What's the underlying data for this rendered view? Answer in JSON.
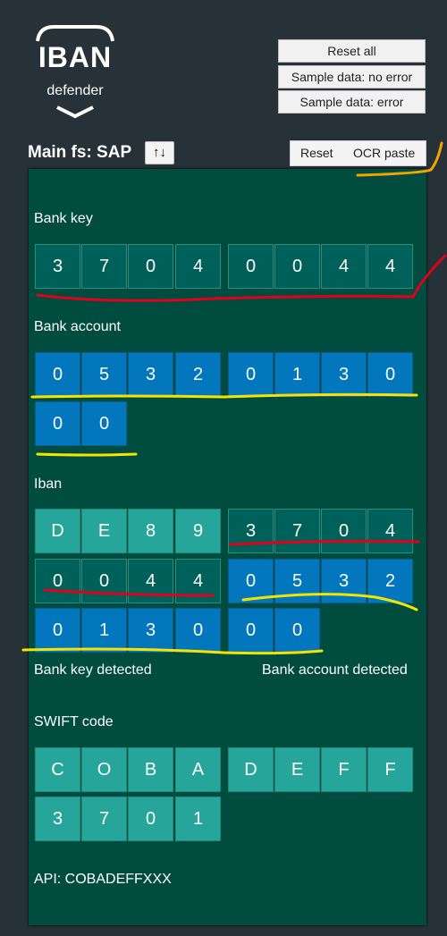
{
  "logo": {
    "title": "IBAN",
    "subtitle": "defender"
  },
  "buttons": {
    "reset_all": "Reset all",
    "sample_no_error": "Sample data: no error",
    "sample_error": "Sample data: error"
  },
  "main": {
    "label": "Main fs: SAP",
    "swap_icon": "↑↓"
  },
  "toolbar": {
    "reset": "Reset",
    "ocr_paste": "OCR paste"
  },
  "sections": {
    "bank_key": {
      "label": "Bank key",
      "digits": [
        "3",
        "7",
        "0",
        "4",
        "0",
        "0",
        "4",
        "4"
      ]
    },
    "bank_account": {
      "label": "Bank account",
      "digits": [
        "0",
        "5",
        "3",
        "2",
        "0",
        "1",
        "3",
        "0",
        "0",
        "0"
      ]
    },
    "iban": {
      "label": "Iban",
      "digits": [
        "D",
        "E",
        "8",
        "9",
        "3",
        "7",
        "0",
        "4",
        "0",
        "0",
        "4",
        "4",
        "0",
        "5",
        "3",
        "2",
        "0",
        "1",
        "3",
        "0",
        "0",
        "0"
      ]
    },
    "status": {
      "bank_key_detected": "Bank key detected",
      "bank_account_detected": "Bank account detected"
    },
    "swift": {
      "label": "SWIFT code",
      "chars": [
        "C",
        "O",
        "B",
        "A",
        "D",
        "E",
        "F",
        "F",
        "3",
        "7",
        "0",
        "1"
      ]
    },
    "api": "API: COBADEFFXXX"
  },
  "colors": {
    "background": "#263238",
    "panel": "#004d40",
    "bank_key_cell": "#00605a",
    "account_cell": "#0277bd",
    "country_check_cell": "#26a69a",
    "annotation_red": "#e3001b",
    "annotation_yellow": "#f5e400",
    "annotation_orange": "#f5a300"
  }
}
